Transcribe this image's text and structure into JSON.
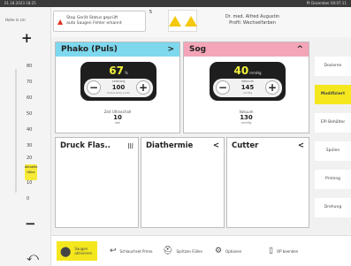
{
  "status": {
    "left": "01.18.2023  18:25",
    "right": "Pt Dezember 00:07:11"
  },
  "left": {
    "header": "Hohe in cm",
    "plus": "+",
    "minus": "−",
    "ticks": [
      "80",
      "70",
      "60",
      "50",
      "40",
      "30",
      "20",
      "10",
      "0"
    ],
    "marker": [
      "Aktuelle",
      "Höhe"
    ],
    "back_icon": "back-arrow-icon"
  },
  "alerts": {
    "alert1_line1": "Stop Gerät Status geprüft",
    "alert1_line2": "auto Saugen Fehler erkannt",
    "alert1_count": "5",
    "caution_icon": "warning-triangle-icon",
    "doctor_line1": "Dr. med. Alfred Augustin",
    "doctor_line2": "Profil: Wechselfarben"
  },
  "phako": {
    "title": "Phako (Puls)",
    "chevron": ">",
    "value": "67",
    "unit": "%",
    "stepper_cap": "Leistung",
    "stepper_value": "100",
    "stepper_sub": "Puls/s  Duty  Limit",
    "minus": "−",
    "plus": "+",
    "foot_label": "Zeit Ultraschall",
    "foot_value": "10",
    "foot_unit": "sek"
  },
  "sog": {
    "title": "Sog",
    "chevron": "^",
    "value": "40",
    "unit": "mmHg",
    "stepper_cap": "Vakuum",
    "stepper_value": "145",
    "stepper_sub": "mmHg",
    "minus": "−",
    "plus": "+",
    "foot_label": "Vakuum",
    "foot_value": "130",
    "foot_unit": "mmHg"
  },
  "small": {
    "druck_title": "Druck Flas..",
    "druck_icon": "|||",
    "dia_title": "Diathermie",
    "dia_chevron": "<",
    "cutter_title": "Cutter",
    "cutter_chevron": "<"
  },
  "right": {
    "items": [
      "Dosieren",
      "Modifiziert",
      "EPI Behälter",
      "Spülen",
      "Priming",
      "Drehung"
    ],
    "active_index": 1
  },
  "bottom": {
    "item1": "Saugen aktivieren",
    "item2": "Schlauchset Prime",
    "item3": "Spritzen Füllen",
    "item4": "Optionen",
    "item5": "OP beenden"
  }
}
